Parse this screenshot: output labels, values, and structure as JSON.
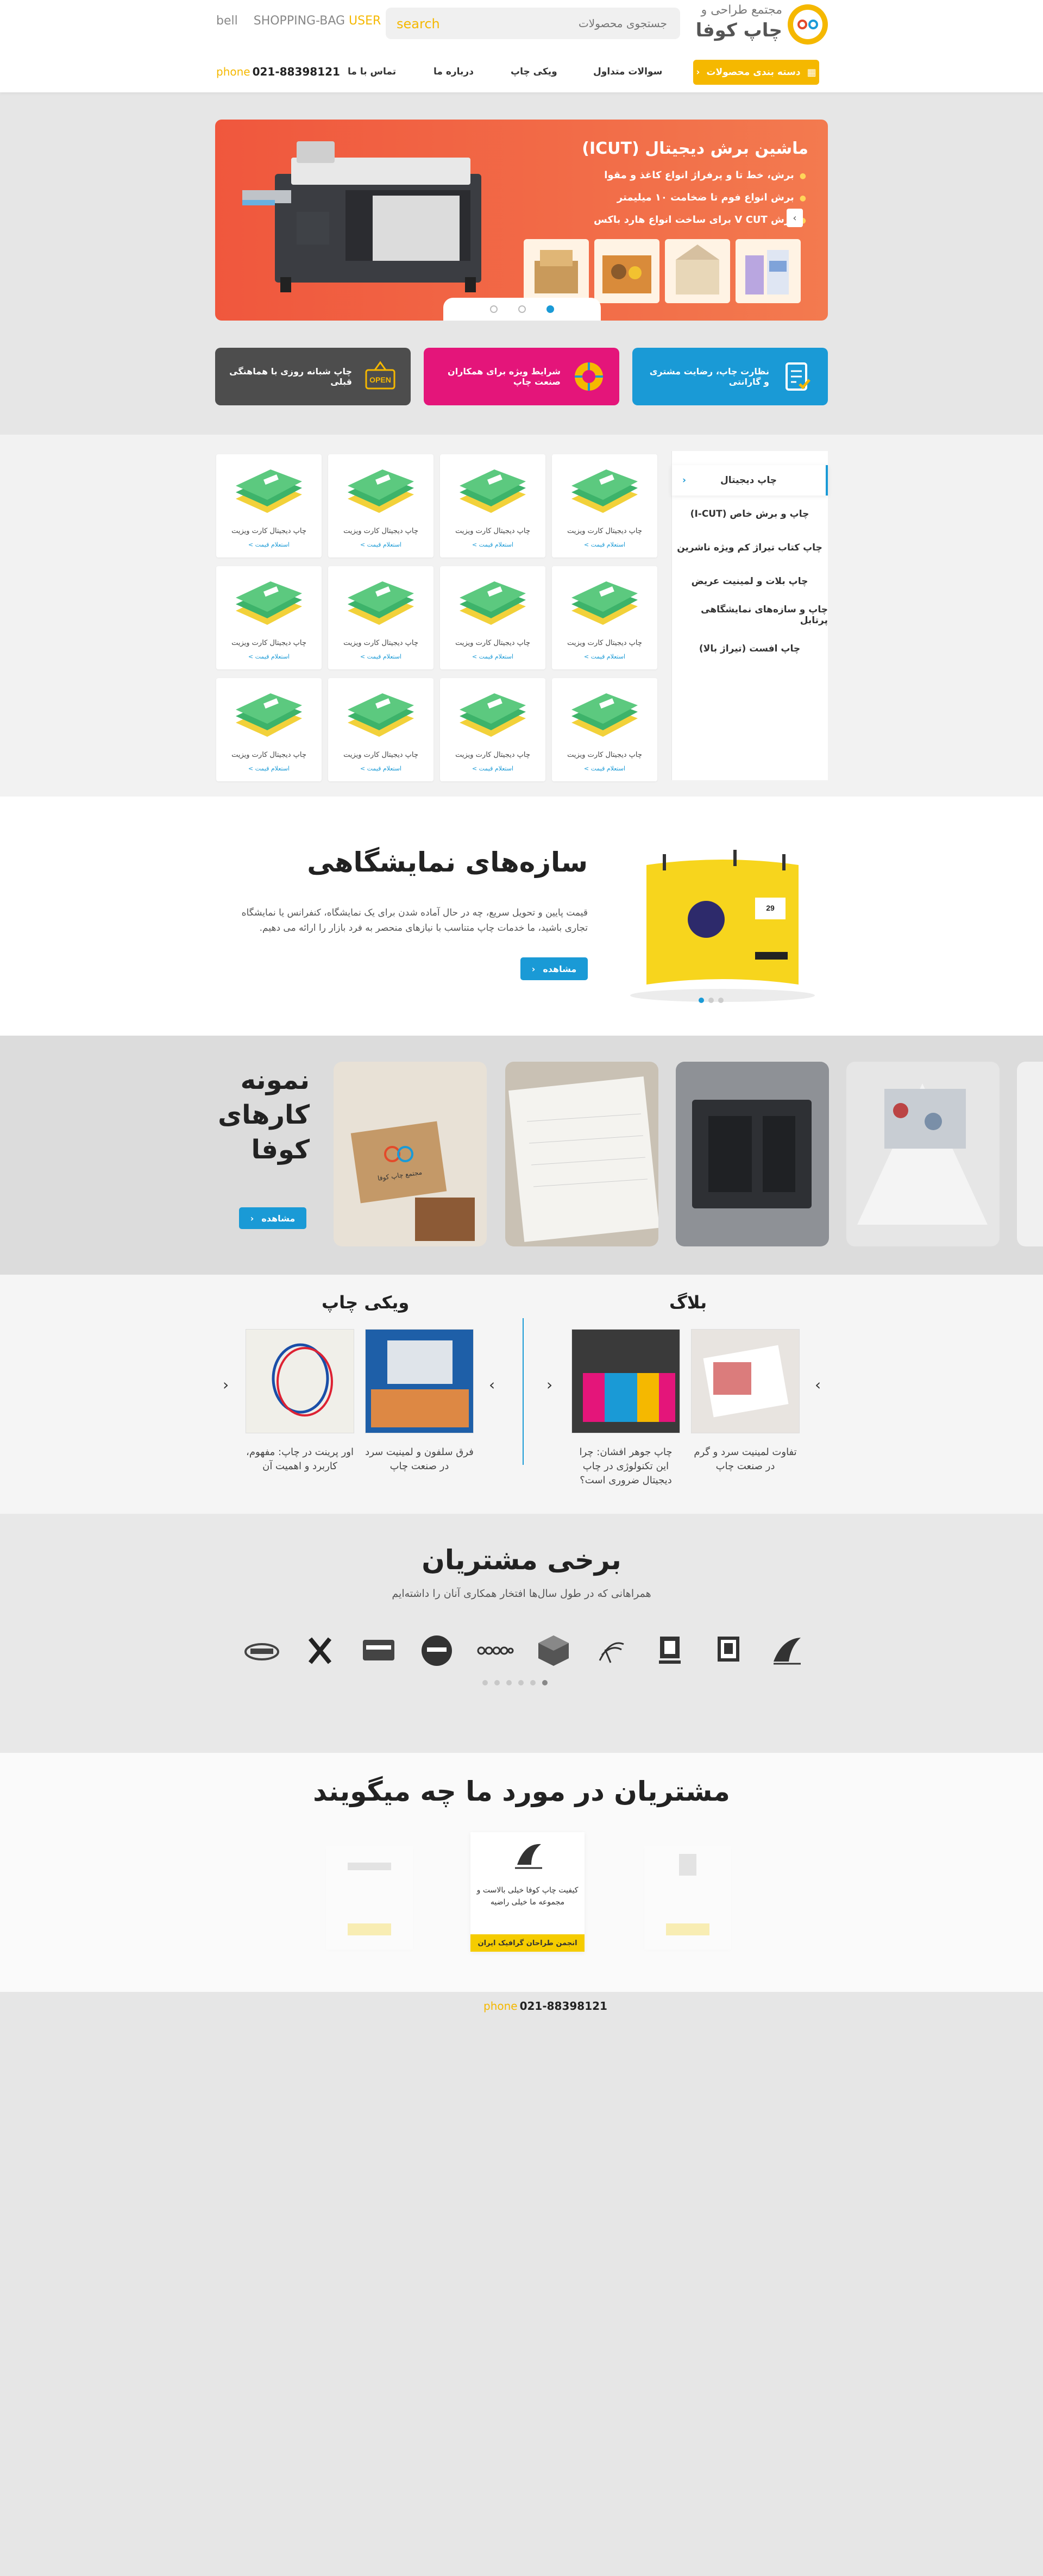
{
  "header": {
    "logo_text_line1": "مجتمع طراحی و",
    "logo_text_line2": "چاپ کوفا",
    "search_placeholder": "جستجوی محصولات",
    "search_label": "search",
    "top_links": {
      "bell": "bell",
      "shopping_bag": "SHOPPING-BAG",
      "user": "USER"
    },
    "category_button": "دسته بندی محصولات",
    "nav": [
      "سوالات متداول",
      "ویکی چاپ",
      "درباره ما",
      "تماس با ما"
    ],
    "phone_icon": "phone",
    "phone_number": "021-88398121"
  },
  "hero": {
    "title": "ماشین برش دیجیتال (ICUT)",
    "bullets": [
      "برش، خط تا و پرفراژ انواع کاغذ و مقوا",
      "برش انواع فوم تا ضخامت ۱۰ میلیمتر",
      "برش V CUT برای ساخت انواع هارد باکس"
    ],
    "slide_count": 3,
    "active_slide": 0
  },
  "features": [
    {
      "label": "نظارت چاپ، رضایت مشتری و گارانتی",
      "color": "#1a9ad6",
      "icon": "checklist-icon"
    },
    {
      "label": "شرایط ویژه برای همکاران صنعت چاپ",
      "color": "#e4157a",
      "icon": "color-wheel-icon"
    },
    {
      "label": "چاپ شبانه روزی با هماهنگی قبلی",
      "color": "#4d4d4d",
      "icon": "open-sign-icon"
    }
  ],
  "products": {
    "categories": [
      "چاپ دیجیتال",
      "چاپ و برش خاص (I-CUT)",
      "چاپ کتاب تیراژ کم ویژه ناشرین",
      "چاپ بلات و لمینیت عریض",
      "چاپ و سازه‌های نمایشگاهی پرتابل",
      "چاپ افست (تیراژ بالا)"
    ],
    "active_category": 0,
    "item_name": "چاپ دیجیتال کارت ویزیت",
    "item_price_label": "استعلام قیمت >"
  },
  "exhibition": {
    "title": "سازه‌های نمایشگاهی",
    "description": "قیمت پایین و تحویل سریع، چه در حال آماده شدن برای یک نمایشگاه، کنفرانس یا نمایشگاه تجاری باشید، ما خدمات چاپ متناسب با نیازهای منحصر به فرد بازار را ارائه می دهیم.",
    "button": "مشاهده",
    "dots": 3,
    "active_dot": 0
  },
  "portfolio": {
    "title_lines": [
      "نمونه",
      "کارهای",
      "کوفا"
    ],
    "button": "مشاهده",
    "card_logo_text": "مجتمع چاپ کوفا"
  },
  "blog": {
    "title": "بلاگ",
    "posts": [
      "تفاوت لمینیت سرد و گرم در صنعت چاپ",
      "چاپ جوهر افشان: چرا این تکنولوژی در چاپ دیجیتال ضروری است؟"
    ]
  },
  "wiki": {
    "title": "ویکی چاپ",
    "posts": [
      "فرق سلفون و لمینیت سرد در صنعت چاپ",
      "اور پرینت در چاپ: مفهوم، کاربرد و اهمیت آن"
    ]
  },
  "customers": {
    "title": "برخی مشتریان",
    "subtitle": "همراهانی که در طول سال‌ها افتخار همکاری آنان را داشته‌ایم",
    "logos": [
      "logo-1",
      "logo-2",
      "logo-3",
      "logo-4",
      "logo-5",
      "logo-6",
      "logo-7",
      "logo-8",
      "logo-9",
      "logo-10",
      "logo-11"
    ],
    "dots": 6,
    "active_dot": 5
  },
  "testimonials": {
    "title": "مشتریان در مورد ما چه میگویند",
    "center": {
      "quote": "کیفیت چاپ کوفا خیلی بالاست و مجموعه ما خیلی راضیه",
      "author": "انجمن طراحان گرافیک ایران"
    },
    "left": {
      "quote": "",
      "author": ""
    },
    "right": {
      "quote": "",
      "author": ""
    }
  },
  "footer": {
    "phone_icon": "phone",
    "phone_number": "021-88398121"
  }
}
